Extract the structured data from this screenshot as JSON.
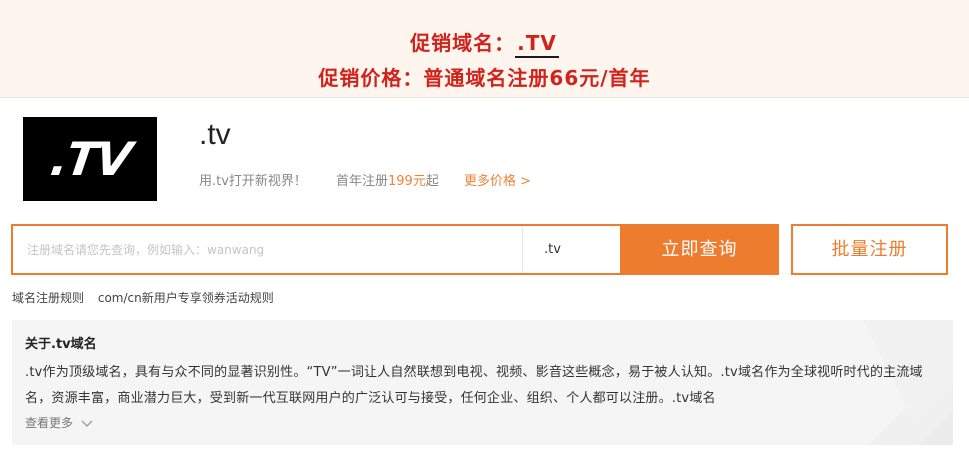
{
  "promo": {
    "line1_label": "促销域名：",
    "line1_value": ".TV",
    "line2": "促销价格：普通域名注册66元/首年"
  },
  "domain": {
    "logo_text": ".TV",
    "title": ".tv",
    "slogan": "用.tv打开新视界！",
    "price_prefix": "首年注册",
    "price_amount": "199元",
    "price_suffix": "起",
    "more_price": "更多价格 >"
  },
  "search": {
    "placeholder": "注册域名请您先查询，例如输入：wanwang",
    "value": "",
    "suffix": ".tv",
    "query_label": "立即查询",
    "bulk_label": "批量注册"
  },
  "rules": {
    "link1": "域名注册规则",
    "link2": "com/cn新用户专享领券活动规则"
  },
  "about": {
    "title": "关于.tv域名",
    "text": ".tv作为顶级域名，具有与众不同的显著识别性。“TV”一词让人自然联想到电视、视频、影音这些概念，易于被人认知。.tv域名作为全球视听时代的主流域名，资源丰富，商业潜力巨大，受到新一代互联网用户的广泛认可与接受，任何企业、组织、个人都可以注册。.tv域名",
    "view_more": "查看更多"
  },
  "colors": {
    "accent": "#ed7c2f",
    "promo_red": "#d1231b",
    "promo_bg": "#fdf5ee"
  }
}
